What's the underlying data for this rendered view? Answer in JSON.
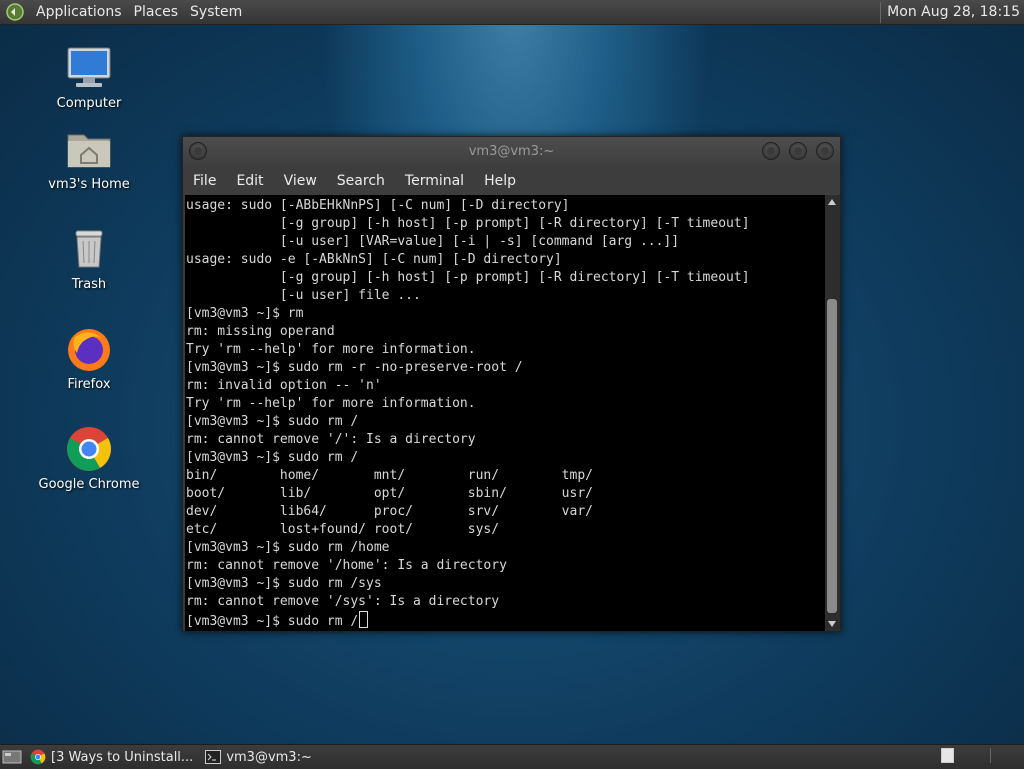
{
  "top_panel": {
    "menus": [
      "Applications",
      "Places",
      "System"
    ],
    "clock": "Mon Aug 28, 18:15"
  },
  "desktop_icons": [
    {
      "label": "Computer",
      "icon": "computer-icon"
    },
    {
      "label": "vm3's Home",
      "icon": "home-folder-icon"
    },
    {
      "label": "Trash",
      "icon": "trash-icon"
    },
    {
      "label": "Firefox",
      "icon": "firefox-icon"
    },
    {
      "label": "Google Chrome",
      "icon": "chrome-icon"
    }
  ],
  "terminal": {
    "title": "vm3@vm3:~",
    "menu": [
      "File",
      "Edit",
      "View",
      "Search",
      "Terminal",
      "Help"
    ],
    "lines": [
      "usage: sudo [-ABbEHkNnPS] [-C num] [-D directory]",
      "            [-g group] [-h host] [-p prompt] [-R directory] [-T timeout]",
      "            [-u user] [VAR=value] [-i | -s] [command [arg ...]]",
      "usage: sudo -e [-ABkNnS] [-C num] [-D directory]",
      "            [-g group] [-h host] [-p prompt] [-R directory] [-T timeout]",
      "            [-u user] file ...",
      "[vm3@vm3 ~]$ rm",
      "rm: missing operand",
      "Try 'rm --help' for more information.",
      "[vm3@vm3 ~]$ sudo rm -r -no-preserve-root /",
      "rm: invalid option -- 'n'",
      "Try 'rm --help' for more information.",
      "[vm3@vm3 ~]$ sudo rm /",
      "rm: cannot remove '/': Is a directory",
      "[vm3@vm3 ~]$ sudo rm /",
      "bin/        home/       mnt/        run/        tmp/",
      "boot/       lib/        opt/        sbin/       usr/",
      "dev/        lib64/      proc/       srv/        var/",
      "etc/        lost+found/ root/       sys/",
      "[vm3@vm3 ~]$ sudo rm /home",
      "rm: cannot remove '/home': Is a directory",
      "[vm3@vm3 ~]$ sudo rm /sys",
      "rm: cannot remove '/sys': Is a directory"
    ],
    "prompt_line": "[vm3@vm3 ~]$ sudo rm /"
  },
  "taskbar": {
    "tasks": [
      {
        "label": "[3 Ways to Uninstall...",
        "icon": "chrome-icon"
      },
      {
        "label": "vm3@vm3:~",
        "icon": "terminal-icon"
      }
    ]
  },
  "colors": {
    "panel_bg": "#3d3d3d",
    "terminal_bg": "#000000",
    "terminal_fg": "#d8d8d8",
    "desktop_bg": "#0f3c5e"
  }
}
